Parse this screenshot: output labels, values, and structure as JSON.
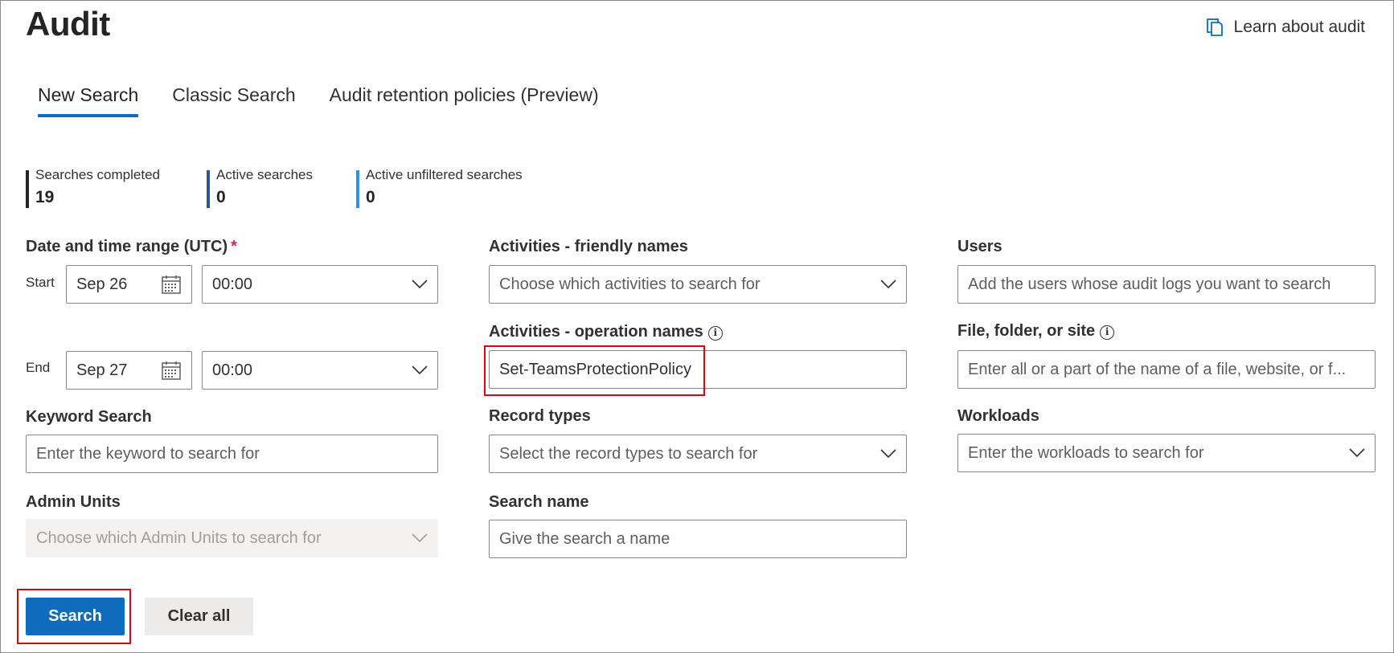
{
  "page": {
    "title": "Audit",
    "learn_link": "Learn about audit"
  },
  "tabs": [
    {
      "label": "New Search",
      "active": true
    },
    {
      "label": "Classic Search",
      "active": false
    },
    {
      "label": "Audit retention policies (Preview)",
      "active": false
    }
  ],
  "stats": [
    {
      "label": "Searches completed",
      "value": "19",
      "color": "#252423"
    },
    {
      "label": "Active searches",
      "value": "0",
      "color": "#2b5797"
    },
    {
      "label": "Active unfiltered searches",
      "value": "0",
      "color": "#2f8ee8"
    }
  ],
  "date_range": {
    "label": "Date and time range (UTC)",
    "required_mark": "*",
    "start_label": "Start",
    "start_date": "Sep 26",
    "start_time": "00:00",
    "end_label": "End",
    "end_date": "Sep 27",
    "end_time": "00:00"
  },
  "keyword": {
    "label": "Keyword Search",
    "placeholder": "Enter the keyword to search for"
  },
  "admin_units": {
    "label": "Admin Units",
    "placeholder": "Choose which Admin Units to search for"
  },
  "activities_friendly": {
    "label": "Activities - friendly names",
    "placeholder": "Choose which activities to search for"
  },
  "activities_operation": {
    "label": "Activities - operation names",
    "value": "Set-TeamsProtectionPolicy"
  },
  "record_types": {
    "label": "Record types",
    "placeholder": "Select the record types to search for"
  },
  "search_name": {
    "label": "Search name",
    "placeholder": "Give the search a name"
  },
  "users": {
    "label": "Users",
    "placeholder": "Add the users whose audit logs you want to search"
  },
  "file_folder": {
    "label": "File, folder, or site",
    "placeholder": "Enter all or a part of the name of a file, website, or f..."
  },
  "workloads": {
    "label": "Workloads",
    "placeholder": "Enter the workloads to search for"
  },
  "buttons": {
    "search": "Search",
    "clear": "Clear all"
  },
  "colors": {
    "accent": "#0f6cbd",
    "highlight": "#e3000f",
    "required": "#c4314b"
  }
}
